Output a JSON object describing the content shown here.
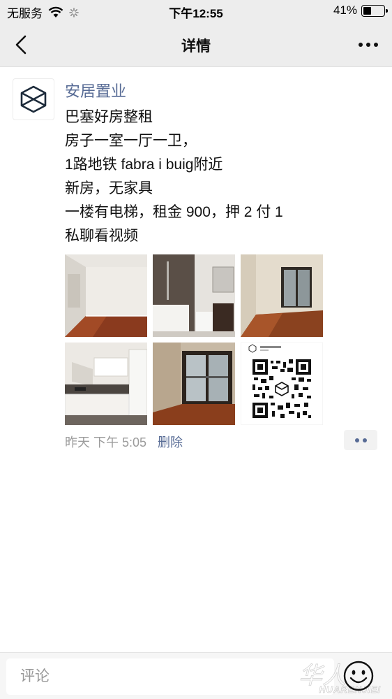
{
  "status_bar": {
    "carrier": "无服务",
    "time": "下午12:55",
    "battery_percent": "41%",
    "battery_level": 0.41
  },
  "nav": {
    "title": "详情",
    "back_icon": "chevron-left-icon",
    "more_icon": "more-dots-icon"
  },
  "post": {
    "author": "安居置业",
    "avatar_icon": "cube-logo-icon",
    "lines": [
      "巴塞好房整租",
      "房子一室一厅一卫，",
      "1路地铁 fabra i buig附近",
      "新房，无家具",
      "一楼有电梯，租金 900，押 2 付 1",
      "私聊看视频"
    ],
    "photos": [
      "empty-room-photo",
      "bathroom-photo",
      "bedroom-balcony-photo",
      "kitchen-photo",
      "balcony-door-photo",
      "qr-code-photo"
    ],
    "time": "昨天  下午 5:05",
    "delete_label": "删除"
  },
  "comment_bar": {
    "placeholder": "评论",
    "emoji_icon": "smiley-face-icon",
    "watermark_glyph": "华人",
    "watermark_text": "HUARENJIEI"
  },
  "colors": {
    "link_blue": "#576b95",
    "bar_gray": "#ededed",
    "meta_gray": "#9b9b9b"
  }
}
